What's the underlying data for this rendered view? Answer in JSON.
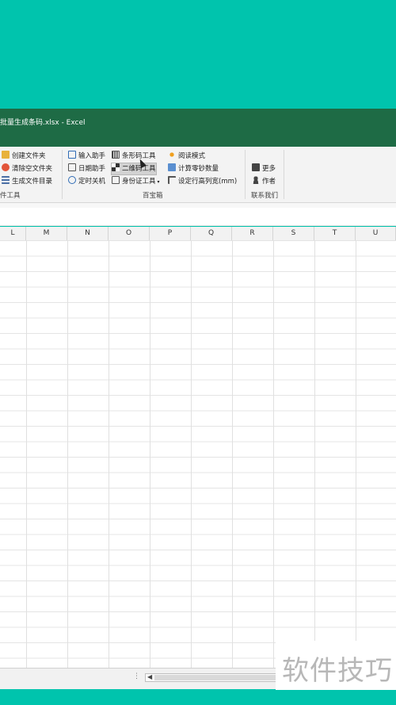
{
  "window": {
    "title": "批量生成条码.xlsx  -  Excel"
  },
  "ribbon": {
    "file_tools": {
      "items": [
        {
          "label": "创建文件夹",
          "icon": "folder-create-icon"
        },
        {
          "label": "清除空文件夹",
          "icon": "folder-clear-icon"
        },
        {
          "label": "生成文件目录",
          "icon": "list-icon"
        }
      ],
      "group_label": "件工具"
    },
    "treasure_box": {
      "col1": [
        {
          "label": "输入助手",
          "icon": "input-assist-icon"
        },
        {
          "label": "日期助手",
          "icon": "calendar-icon"
        },
        {
          "label": "定时关机",
          "icon": "clock-icon"
        }
      ],
      "col2": [
        {
          "label": "条形码工具",
          "icon": "barcode-icon"
        },
        {
          "label": "二维码工具",
          "icon": "qrcode-icon",
          "selected": true
        },
        {
          "label": "身份证工具",
          "icon": "id-card-icon",
          "has_dropdown": true
        }
      ],
      "col3": [
        {
          "label": "阅读模式",
          "icon": "sun-icon"
        },
        {
          "label": "计算零钞数量",
          "icon": "cash-icon"
        },
        {
          "label": "设定行高列宽(mm)",
          "icon": "row-height-icon"
        }
      ],
      "group_label": "百宝箱"
    },
    "contact": {
      "items": [
        {
          "label": "更多",
          "icon": "briefcase-icon"
        },
        {
          "label": "作者",
          "icon": "person-icon"
        }
      ],
      "group_label": "联系我们"
    }
  },
  "sheet": {
    "columns": [
      "L",
      "M",
      "N",
      "O",
      "P",
      "Q",
      "R",
      "S",
      "T",
      "U"
    ]
  },
  "statusbar": {
    "dots": "⋮"
  },
  "watermark": {
    "text": "软件技巧"
  },
  "colors": {
    "title_bar": "#1e6b45",
    "background": "#00c4ad"
  }
}
